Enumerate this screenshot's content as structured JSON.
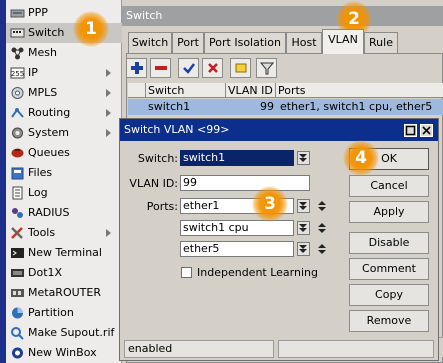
{
  "sidebar": {
    "items": [
      {
        "label": "PPP",
        "icon": "ppp-icon",
        "has_submenu": false
      },
      {
        "label": "Switch",
        "icon": "switch-icon",
        "has_submenu": false,
        "selected": true
      },
      {
        "label": "Mesh",
        "icon": "mesh-icon",
        "has_submenu": false
      },
      {
        "label": "IP",
        "icon": "ip-icon",
        "has_submenu": true
      },
      {
        "label": "MPLS",
        "icon": "mpls-icon",
        "has_submenu": true
      },
      {
        "label": "Routing",
        "icon": "routing-icon",
        "has_submenu": true
      },
      {
        "label": "System",
        "icon": "system-icon",
        "has_submenu": true
      },
      {
        "label": "Queues",
        "icon": "queues-icon",
        "has_submenu": false
      },
      {
        "label": "Files",
        "icon": "files-icon",
        "has_submenu": false
      },
      {
        "label": "Log",
        "icon": "log-icon",
        "has_submenu": false
      },
      {
        "label": "RADIUS",
        "icon": "radius-icon",
        "has_submenu": false
      },
      {
        "label": "Tools",
        "icon": "tools-icon",
        "has_submenu": true
      },
      {
        "label": "New Terminal",
        "icon": "terminal-icon",
        "has_submenu": false
      },
      {
        "label": "Dot1X",
        "icon": "dot1x-icon",
        "has_submenu": false
      },
      {
        "label": "MetaROUTER",
        "icon": "metarouter-icon",
        "has_submenu": false
      },
      {
        "label": "Partition",
        "icon": "partition-icon",
        "has_submenu": false
      },
      {
        "label": "Make Supout.rif",
        "icon": "supout-icon",
        "has_submenu": false
      },
      {
        "label": "New WinBox",
        "icon": "winbox-icon",
        "has_submenu": false
      }
    ]
  },
  "switch_window": {
    "title": "Switch",
    "tabs": [
      "Switch",
      "Port",
      "Port Isolation",
      "Host",
      "VLAN",
      "Rule"
    ],
    "active_tab": "VLAN",
    "toolbar": [
      "add-icon",
      "remove-icon",
      "enable-icon",
      "disable-icon",
      "comment-icon",
      "filter-icon"
    ],
    "columns": [
      "Switch",
      "VLAN ID",
      "Ports"
    ],
    "rows": [
      {
        "switch": "switch1",
        "vlan_id": "99",
        "ports": "ether1, switch1 cpu, ether5"
      }
    ],
    "status": "enabled"
  },
  "dialog": {
    "title": "Switch VLAN <99>",
    "switch_label": "Switch:",
    "switch_value": "switch1",
    "vlan_id_label": "VLAN ID:",
    "vlan_id_value": "99",
    "ports_label": "Ports:",
    "ports": [
      "ether1",
      "switch1 cpu",
      "ether5"
    ],
    "independent_learning_label": "Independent Learning",
    "independent_learning_checked": false,
    "buttons": [
      "OK",
      "Cancel",
      "Apply",
      "Disable",
      "Comment",
      "Copy",
      "Remove"
    ],
    "status": "enabled"
  },
  "markers": [
    "1",
    "2",
    "3",
    "4"
  ],
  "colors": {
    "marker": "#f39200",
    "dialog_title": "#0c2f8e",
    "selected_row": "#9fb8dd",
    "nav_strip": "#1c2f8a"
  }
}
